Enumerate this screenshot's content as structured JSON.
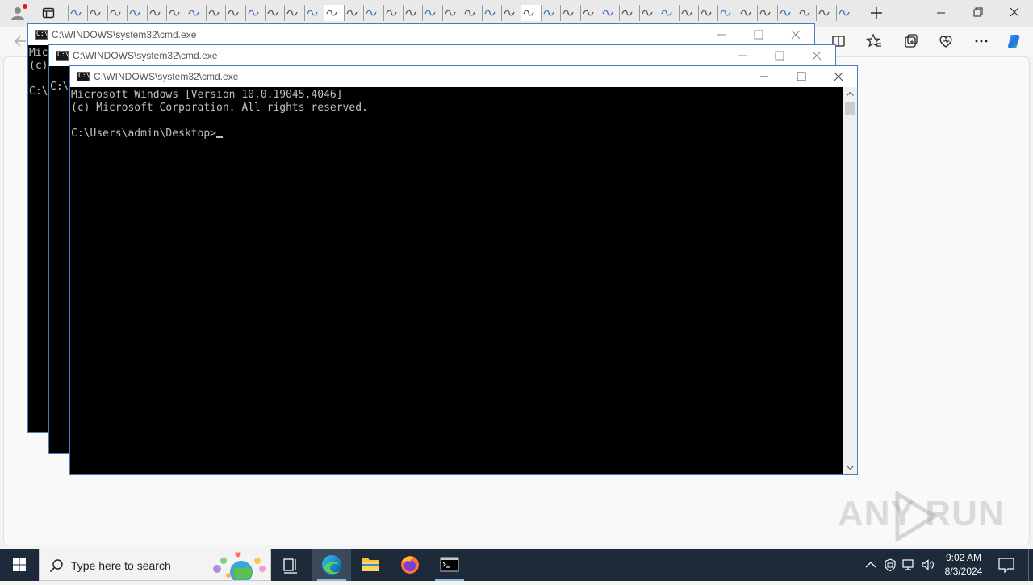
{
  "browser": {
    "tab_count": 40,
    "active_tab_indices": [
      13,
      23
    ]
  },
  "windows": [
    {
      "title": "C:\\WINDOWS\\system32\\cmd.exe",
      "lines": [
        "Mic",
        "(c)",
        "",
        "C:\\"
      ]
    },
    {
      "title": "C:\\WINDOWS\\system32\\cmd.exe",
      "lines": [
        "",
        "C:\\"
      ]
    },
    {
      "title": "C:\\WINDOWS\\system32\\cmd.exe",
      "lines": [
        "Microsoft Windows [Version 10.0.19045.4046]",
        "(c) Microsoft Corporation. All rights reserved.",
        "",
        "C:\\Users\\admin\\Desktop>"
      ]
    }
  ],
  "taskbar": {
    "search_placeholder": "Type here to search",
    "time": "9:02 AM",
    "date": "8/3/2024"
  },
  "watermark": "ANY RUN",
  "icons": {
    "start": "windows-logo-icon",
    "search": "search-icon",
    "task_view": "task-view-icon",
    "apps": [
      "edge-icon",
      "file-explorer-icon",
      "firefox-icon",
      "cmd-icon"
    ],
    "tray": [
      "chevron-up-icon",
      "defender-icon",
      "network-icon",
      "volume-icon"
    ]
  },
  "colors": {
    "taskbar": "#1c2a3a",
    "console_bg": "#000000",
    "console_text": "#c0c0c0",
    "edge_accent": "#0078d4"
  }
}
